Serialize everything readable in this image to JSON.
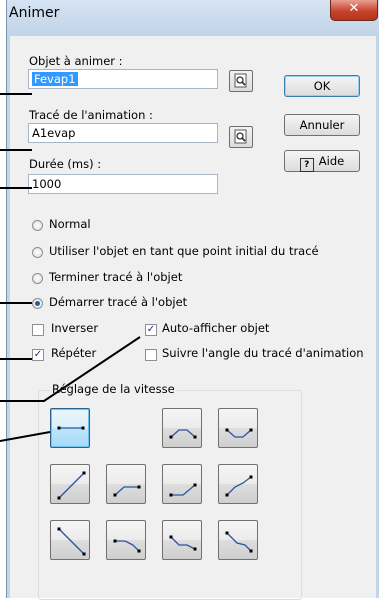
{
  "window": {
    "title": "Animer",
    "close_glyph": "✕"
  },
  "object": {
    "label": "Objet à animer :",
    "value": "Fevap1"
  },
  "path": {
    "label": "Tracé de l'animation :",
    "value": "A1evap"
  },
  "duration": {
    "label": "Durée (ms) :",
    "value": "1000"
  },
  "buttons": {
    "ok": "OK",
    "cancel": "Annuler",
    "help": "Aide",
    "help_icon": "?"
  },
  "radios": [
    {
      "label": "Normal",
      "checked": false
    },
    {
      "label": "Utiliser l'objet en tant que point initial du tracé",
      "checked": false
    },
    {
      "label": "Terminer tracé à l'objet",
      "checked": false
    },
    {
      "label": "Démarrer tracé à l'objet",
      "checked": true
    }
  ],
  "checkboxes": {
    "reverse": {
      "label": "Inverser",
      "checked": false
    },
    "repeat": {
      "label": "Répéter",
      "checked": true
    },
    "autoshow": {
      "label": "Auto-afficher objet",
      "checked": true
    },
    "followangle": {
      "label": "Suivre l'angle du tracé d'animation",
      "checked": false
    }
  },
  "speed": {
    "label": "Réglage de la vitesse",
    "selected_index": 0
  },
  "colors": {
    "titlebar": "#c2d6ea",
    "close": "#c8432b",
    "selection": "#3399ff",
    "accent": "#2a5598"
  }
}
